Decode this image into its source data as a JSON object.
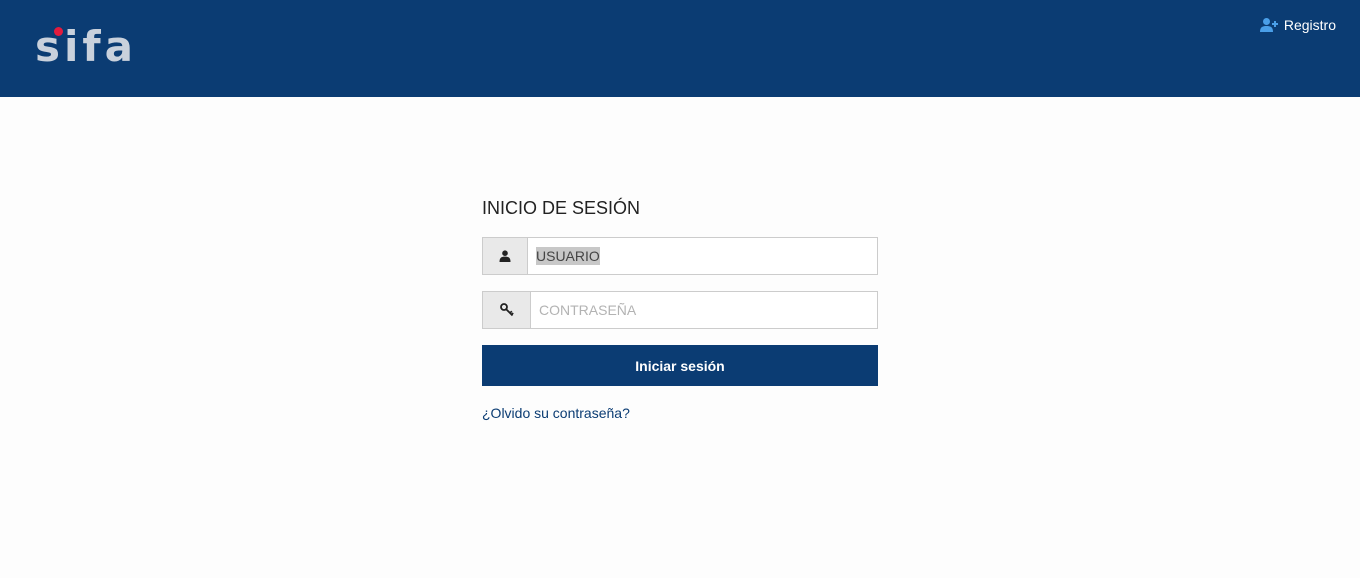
{
  "header": {
    "logo_text": "sifa",
    "register_label": "Registro",
    "register_icon": "user-plus-icon",
    "background_color": "#0b3c73",
    "logo_dot_color": "#e31b3d"
  },
  "login": {
    "title": "INICIO DE SESIÓN",
    "username": {
      "icon": "user-icon",
      "value": "USUARIO"
    },
    "password": {
      "icon": "key-icon",
      "placeholder": "CONTRASEÑA"
    },
    "submit_label": "Iniciar sesión",
    "forgot_label": "¿Olvido su contraseña?"
  }
}
